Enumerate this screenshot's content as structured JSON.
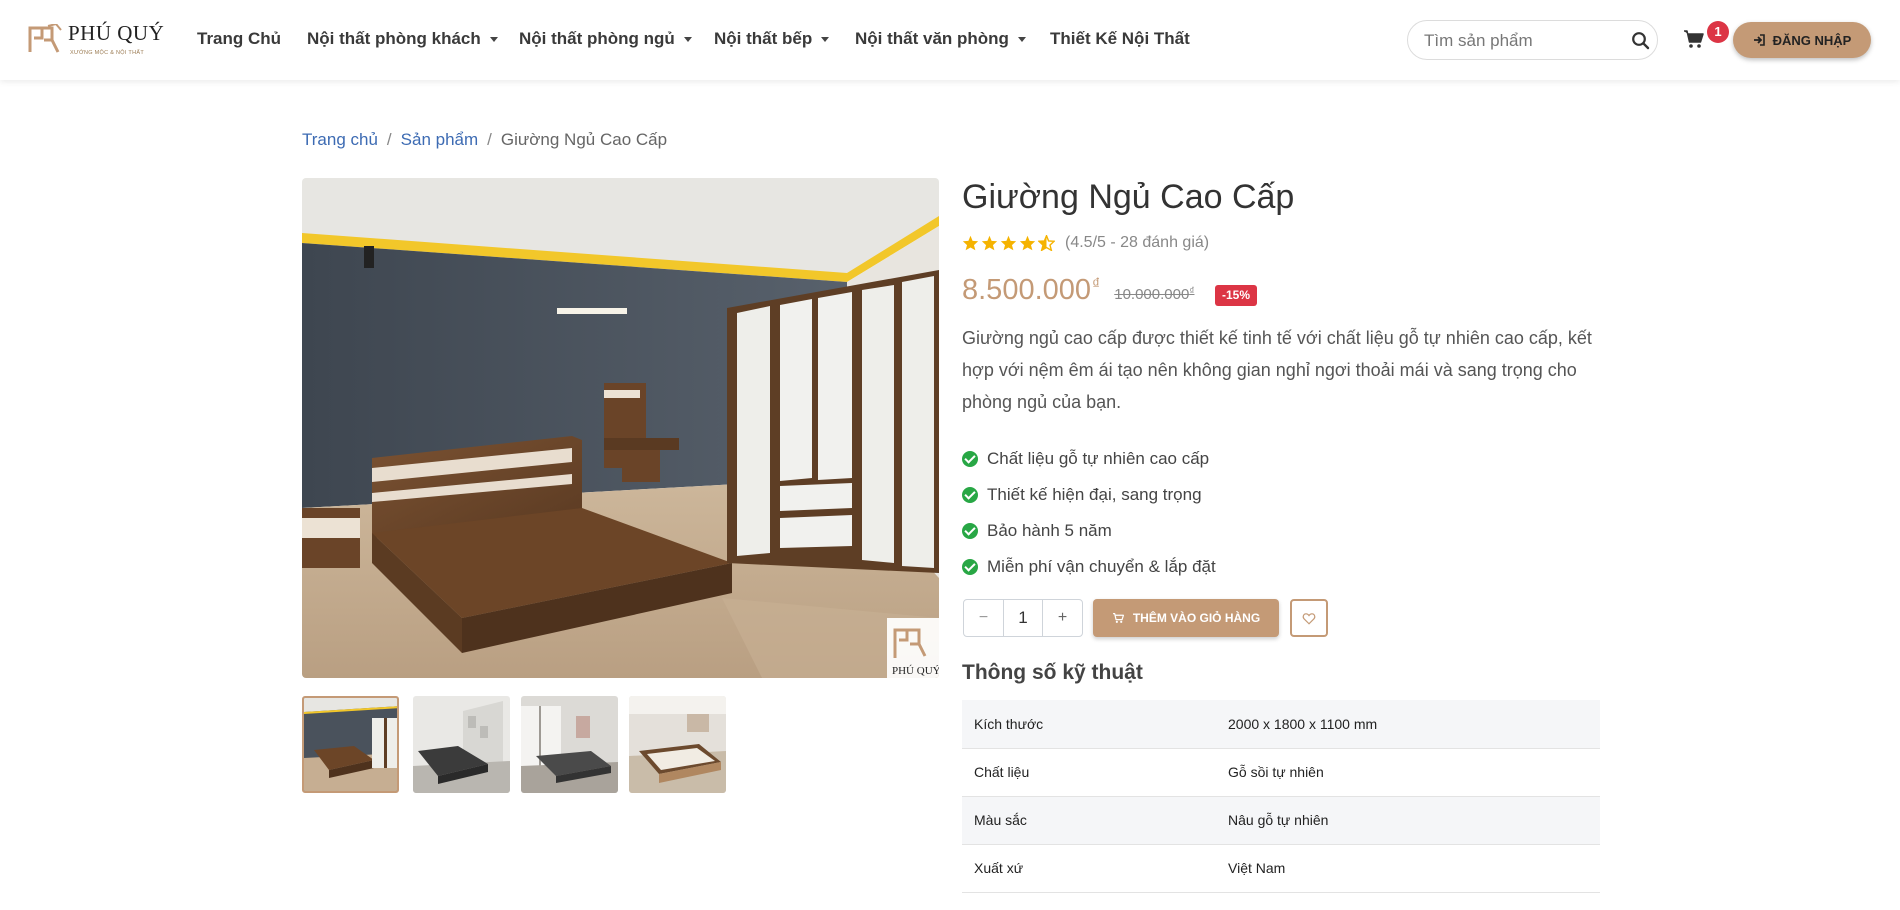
{
  "header": {
    "logo": {
      "text": "PHÚ QUÝ",
      "subtitle": "XƯỞNG MỘC & NỘI THẤT"
    },
    "nav": [
      {
        "label": "Trang Chủ",
        "dropdown": false
      },
      {
        "label": "Nội thất phòng khách",
        "dropdown": true
      },
      {
        "label": "Nội thất phòng ngủ",
        "dropdown": true
      },
      {
        "label": "Nội thất bếp",
        "dropdown": true
      },
      {
        "label": "Nội thất văn phòng",
        "dropdown": true
      },
      {
        "label": "Thiết Kế Nội Thất",
        "dropdown": false
      }
    ],
    "search": {
      "placeholder": "Tìm sản phẩm",
      "icon": "search-icon"
    },
    "cart": {
      "icon": "cart-icon",
      "count": "1"
    },
    "login": {
      "label": "ĐĂNG NHẬP",
      "icon": "sign-in-icon"
    }
  },
  "breadcrumb": {
    "home": "Trang chủ",
    "category": "Sản phẩm",
    "current": "Giường Ngủ Cao Cấp"
  },
  "product": {
    "title": "Giường Ngủ Cao Cấp",
    "rating": 4.5,
    "rating_text": "(4.5/5 - 28 đánh giá)",
    "price": "8.500.000",
    "currency": "₫",
    "old_price": "10.000.000",
    "discount": "-15%",
    "description": "Giường ngủ cao cấp được thiết kế tinh tế với chất liệu gỗ tự nhiên cao cấp, kết hợp với nệm êm ái tạo nên không gian nghỉ ngơi thoải mái và sang trọng cho phòng ngủ của bạn.",
    "features": [
      "Chất liệu gỗ tự nhiên cao cấp",
      "Thiết kế hiện đại, sang trọng",
      "Bảo hành 5 năm",
      "Miễn phí vận chuyển & lắp đặt"
    ],
    "quantity": "1",
    "qty_minus": "−",
    "qty_plus": "+",
    "add_to_cart": "THÊM VÀO GIỎ HÀNG",
    "watermark": "PHÚ QUÝ",
    "thumbnails_count": 4
  },
  "specs": {
    "title": "Thông số kỹ thuật",
    "rows": [
      {
        "key": "Kích thước",
        "value": "2000 x 1800 x 1100 mm"
      },
      {
        "key": "Chất liệu",
        "value": "Gỗ sồi tự nhiên"
      },
      {
        "key": "Màu sắc",
        "value": "Nâu gỗ tự nhiên"
      },
      {
        "key": "Xuất xứ",
        "value": "Việt Nam"
      }
    ]
  },
  "colors": {
    "accent": "#c49a76",
    "badge": "#dc3545",
    "check": "#28a745",
    "link": "#3d6bb3",
    "star": "#f5b301"
  }
}
